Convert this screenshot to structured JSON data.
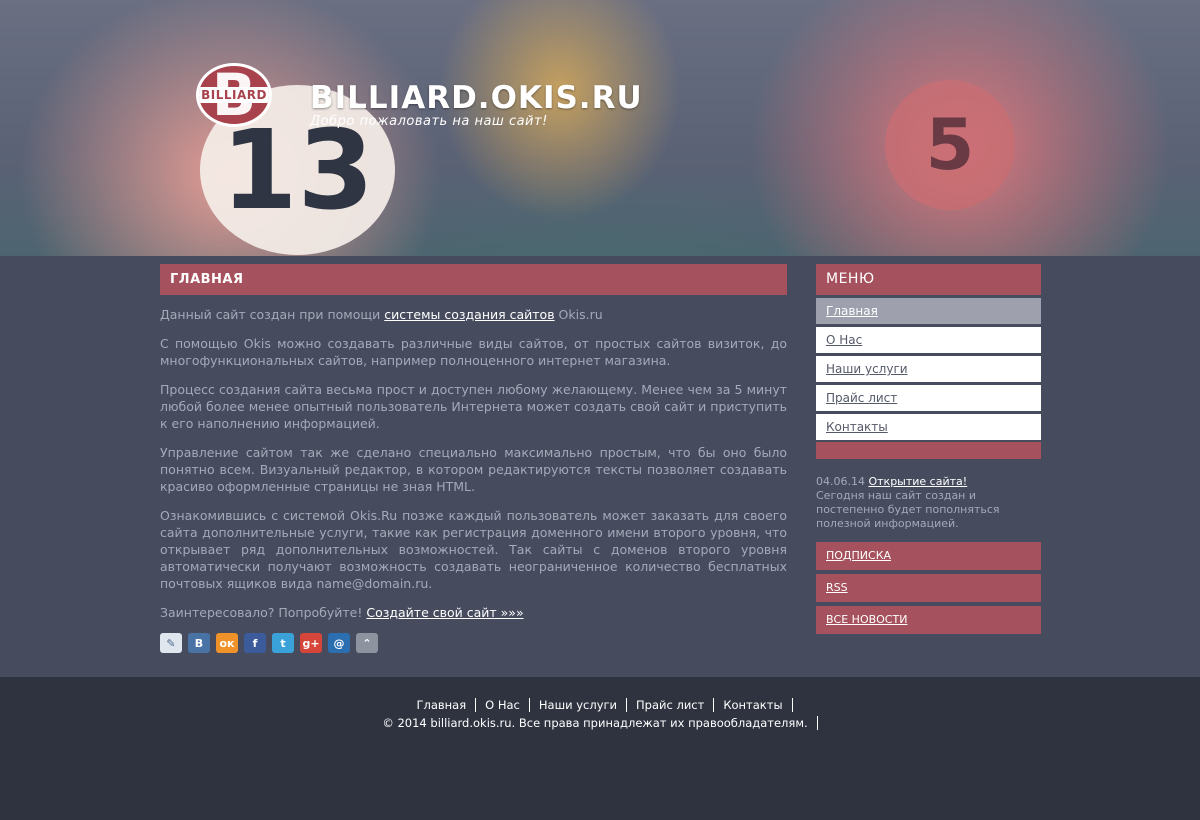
{
  "header": {
    "logo_text": "BILLIARD",
    "logo_letter": "B",
    "site_title": "BILLIARD.OKIS.RU",
    "slogan": "Добро пожаловать на наш сайт!",
    "ball_left": "13",
    "ball_right": "5"
  },
  "main": {
    "heading": "ГЛАВНАЯ",
    "p1_before": "Данный сайт создан при помощи ",
    "p1_link": "системы создания сайтов",
    "p1_after": " Okis.ru",
    "p2": "С помощью Okis можно создавать различные виды сайтов, от простых сайтов визиток, до многофункциональных сайтов, например полноценного интернет магазина.",
    "p3": "Процесс создания сайта весьма прост и доступен любому желающему. Менее чем за 5 минут любой более менее опытный пользователь Интернета может создать свой сайт и приступить к его наполнению информацией.",
    "p4": "Управление сайтом так же сделано специально максимально простым, что бы оно было понятно всем. Визуальный редактор, в котором редактируются тексты позволяет создавать красиво оформленные страницы не зная HTML.",
    "p5": "Ознакомившись с системой Okis.Ru позже каждый пользователь может заказать для своего сайта дополнительные услуги, такие как регистрация доменного имени второго уровня, что открывает ряд дополнительных возможностей. Так сайты с доменов второго уровня автоматически получают возможность создавать неограниченное количество бесплатных почтовых ящиков вида name@domain.ru.",
    "p6_before": "Заинтересовало? Попробуйте! ",
    "p6_link": "Создайте свой сайт »»»",
    "share": [
      {
        "icon": "livejournal-icon",
        "glyph": "✎",
        "color": "#dfe6ee"
      },
      {
        "icon": "vkontakte-icon",
        "glyph": "В",
        "color": "#4a73a5"
      },
      {
        "icon": "odnoklassniki-icon",
        "glyph": "ок",
        "color": "#f0922a"
      },
      {
        "icon": "facebook-icon",
        "glyph": "f",
        "color": "#3b5b9a"
      },
      {
        "icon": "twitter-icon",
        "glyph": "t",
        "color": "#3aa2d9"
      },
      {
        "icon": "google-plus-icon",
        "glyph": "g+",
        "color": "#d5453a"
      },
      {
        "icon": "mail-ru-icon",
        "glyph": "@",
        "color": "#2b6fb0"
      },
      {
        "icon": "more-share-icon",
        "glyph": "⌃",
        "color": "#8d939f"
      }
    ]
  },
  "sidebar": {
    "menu_title": "МЕНЮ",
    "items": [
      {
        "label": "Главная",
        "active": true
      },
      {
        "label": "О Нас",
        "active": false
      },
      {
        "label": "Наши услуги",
        "active": false
      },
      {
        "label": "Прайс лист",
        "active": false
      },
      {
        "label": "Контакты",
        "active": false
      }
    ],
    "news_date": "04.06.14",
    "news_link": "Открытие сайта!",
    "news_text": "Сегодня наш сайт создан и постепенно будет пополняться полезной информацией.",
    "subscribe": "ПОДПИСКА",
    "rss": "RSS",
    "all_news": "ВСЕ НОВОСТИ"
  },
  "footer": {
    "nav": [
      "Главная",
      "О Нас",
      "Наши услуги",
      "Прайс лист",
      "Контакты"
    ],
    "copyright": "© 2014 billiard.okis.ru. Все права принадлежат их правообладателям."
  }
}
